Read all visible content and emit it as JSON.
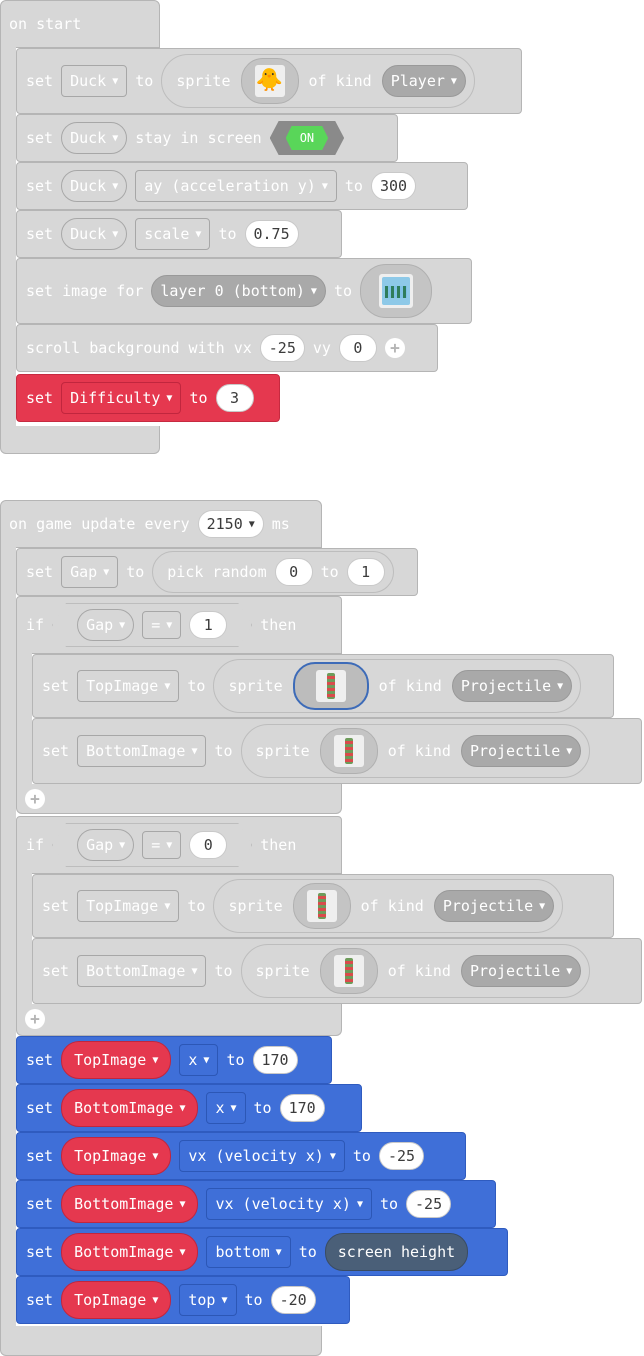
{
  "colors": {
    "disabled": "#d7d7d7",
    "variables": "#e5384f",
    "sprites": "#3f6fd8",
    "scene": "#4a5f78",
    "toggle_on": "#59d659"
  },
  "on_start": {
    "hat": "on start",
    "set_duck": {
      "set": "set",
      "var": "Duck",
      "to": "to",
      "sprite": "sprite",
      "of_kind": "of kind",
      "kind": "Player",
      "image_icon": "duck-icon"
    },
    "stay": {
      "set": "set",
      "var": "Duck",
      "label": "stay in screen",
      "toggle": "ON"
    },
    "ay": {
      "set": "set",
      "var": "Duck",
      "prop": "ay (acceleration y)",
      "to": "to",
      "value": "300"
    },
    "scale": {
      "set": "set",
      "var": "Duck",
      "prop": "scale",
      "to": "to",
      "value": "0.75"
    },
    "image_for": {
      "label": "set image for",
      "layer": "layer 0 (bottom)",
      "to": "to",
      "image_icon": "background-image-icon"
    },
    "scroll": {
      "label": "scroll background with vx",
      "vx": "-25",
      "vy_label": "vy",
      "vy": "0"
    },
    "difficulty": {
      "set": "set",
      "var": "Difficulty",
      "to": "to",
      "value": "3"
    }
  },
  "on_update": {
    "hat_prefix": "on game update every",
    "interval": "2150",
    "hat_suffix": "ms",
    "gap": {
      "set": "set",
      "var": "Gap",
      "to": "to",
      "func": "pick random",
      "min": "0",
      "and": "to",
      "max": "1"
    },
    "if1": {
      "if": "if",
      "var": "Gap",
      "op": "=",
      "value": "1",
      "then": "then"
    },
    "if2": {
      "if": "if",
      "var": "Gap",
      "op": "=",
      "value": "0",
      "then": "then"
    },
    "top_set": {
      "set": "set",
      "var": "TopImage",
      "to": "to",
      "sprite": "sprite",
      "of_kind": "of kind",
      "kind": "Projectile"
    },
    "bottom_set": {
      "set": "set",
      "var": "BottomImage",
      "to": "to",
      "sprite": "sprite",
      "of_kind": "of kind",
      "kind": "Projectile"
    },
    "blue": [
      {
        "set": "set",
        "var": "TopImage",
        "prop": "x",
        "to": "to",
        "value": "170"
      },
      {
        "set": "set",
        "var": "BottomImage",
        "prop": "x",
        "to": "to",
        "value": "170"
      },
      {
        "set": "set",
        "var": "TopImage",
        "prop": "vx (velocity x)",
        "to": "to",
        "value": "-25"
      },
      {
        "set": "set",
        "var": "BottomImage",
        "prop": "vx (velocity x)",
        "to": "to",
        "value": "-25"
      },
      {
        "set": "set",
        "var": "BottomImage",
        "prop": "bottom",
        "to": "to",
        "value": "screen height"
      },
      {
        "set": "set",
        "var": "TopImage",
        "prop": "top",
        "to": "to",
        "value": "-20"
      }
    ]
  }
}
